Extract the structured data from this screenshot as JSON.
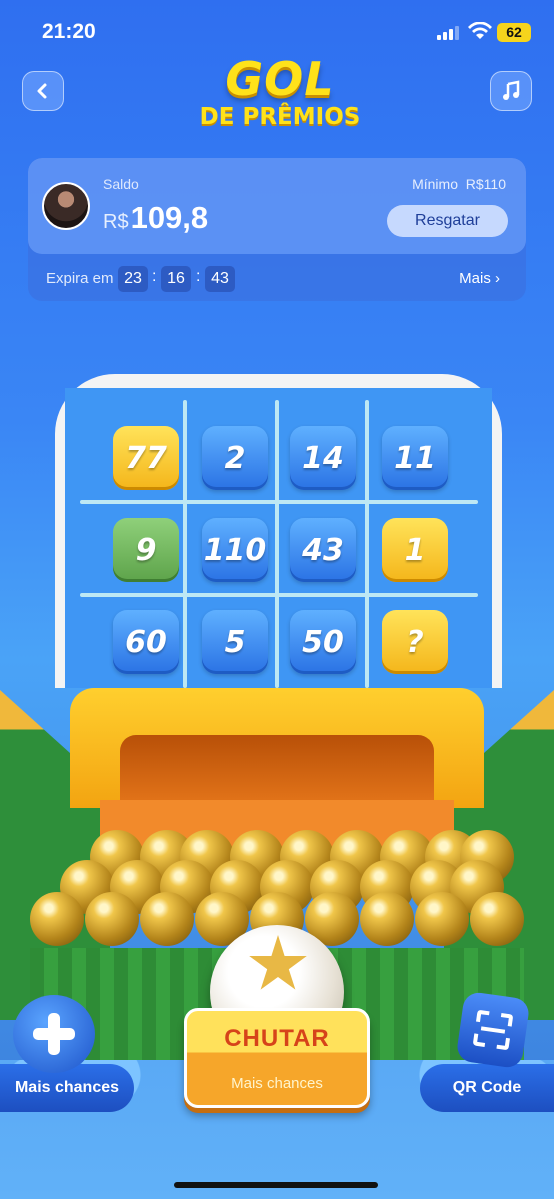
{
  "status_bar": {
    "time": "21:20",
    "battery": "62"
  },
  "header": {
    "logo_line1": "GOL",
    "logo_line2": "DE PRÊMIOS",
    "back_icon": "chevron-left-icon",
    "music_icon": "music-note-icon"
  },
  "balance_card": {
    "saldo_label": "Saldo",
    "currency": "R$",
    "amount": "109,8",
    "minimo_label": "Mínimo",
    "minimo_value": "R$110",
    "resgatar_label": "Resgatar",
    "expira_label": "Expira em",
    "timer": {
      "hours": "23",
      "minutes": "16",
      "seconds": "43",
      "separator": ":"
    },
    "mais_label": "Mais"
  },
  "goal_grid": [
    {
      "value": "77",
      "color": "yellow"
    },
    {
      "value": "2",
      "color": "blue"
    },
    {
      "value": "14",
      "color": "blue"
    },
    {
      "value": "11",
      "color": "blue"
    },
    {
      "value": "9",
      "color": "green"
    },
    {
      "value": "110",
      "color": "blue"
    },
    {
      "value": "43",
      "color": "blue"
    },
    {
      "value": "1",
      "color": "yellow"
    },
    {
      "value": "60",
      "color": "blue"
    },
    {
      "value": "5",
      "color": "blue"
    },
    {
      "value": "50",
      "color": "blue"
    },
    {
      "value": "?",
      "color": "yellow"
    }
  ],
  "bottom": {
    "mais_chances_label": "Mais chances",
    "chutar_label": "CHUTAR",
    "chutar_sub": "Mais chances",
    "qr_code_label": "QR Code"
  },
  "colors": {
    "accent_yellow": "#ffe21a",
    "primary_blue": "#2f6ff0"
  }
}
